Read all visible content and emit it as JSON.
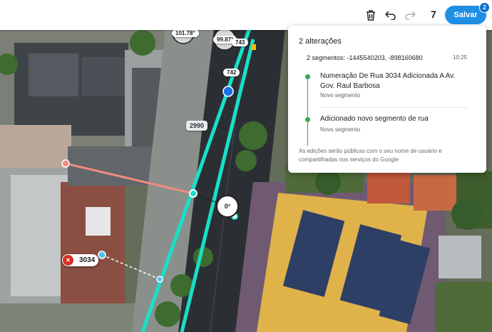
{
  "toolbar": {
    "delete_icon": "trash-icon",
    "undo_icon": "undo-icon",
    "redo_icon": "redo-icon",
    "edit_count": "7",
    "save_label": "Salvar",
    "save_badge": "2"
  },
  "changes_panel": {
    "title": "2 alterações",
    "segments_label": "2 segmentos: -1445540203, -898160680",
    "time": "10:25",
    "entries": [
      {
        "title": "Numeração De Rua 3034 Adicionada A Av. Gov. Raul Barbosa",
        "subtitle": "Novo segmento"
      },
      {
        "title": "Adicionado novo segmento de rua",
        "subtitle": "Novo segmento"
      }
    ],
    "footer": "As edições serão públicas com o seu nome de usuário e compartilhadas nos serviços do Google"
  },
  "map": {
    "speed_labels": [
      "101.78°",
      "99.87°"
    ],
    "segment_labels": [
      "743",
      "742"
    ],
    "house_number_label": "2990",
    "angle_label": "0°",
    "new_house_number": "3034",
    "colors": {
      "road": "#2b2f33",
      "selected_road": "#18e0c9",
      "new_segment": "#f28b82",
      "node": "#4fc3f7",
      "delete": "#d93025"
    }
  }
}
